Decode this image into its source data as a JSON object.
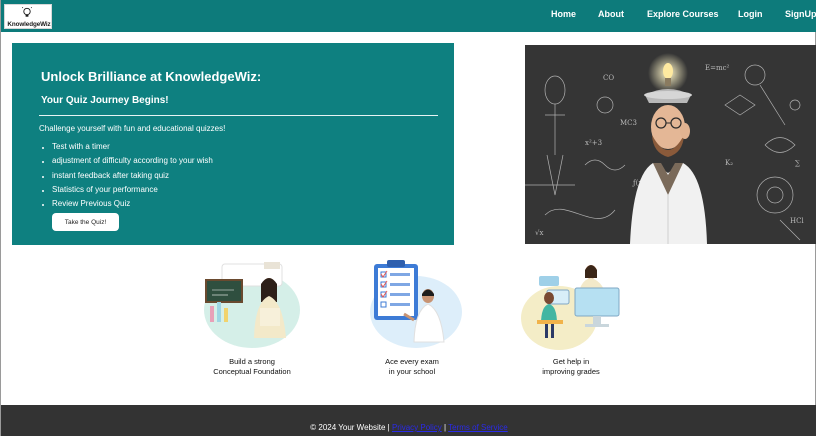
{
  "brand": {
    "logo_text": "KnowledgeWiz"
  },
  "nav": {
    "home": "Home",
    "about": "About",
    "explore": "Explore Courses",
    "login": "Login",
    "signup": "SignUp"
  },
  "hero": {
    "title": "Unlock Brilliance at KnowledgeWiz:",
    "subtitle": "Your Quiz Journey Begins!",
    "intro": "Challenge yourself with fun and educational quizzes!",
    "features": [
      "Test with a timer",
      "adjustment of difficulty according to your wish",
      "instant feedback after taking quiz",
      "Statistics of your performance",
      "Review Previous Quiz"
    ],
    "button_label": "Take the Quiz!"
  },
  "cards": [
    {
      "line1": "Build a strong",
      "line2": "Conceptual Foundation"
    },
    {
      "line1": "Ace every exam",
      "line2": "in your school"
    },
    {
      "line1": "Get help in",
      "line2": "improving grades"
    }
  ],
  "footer": {
    "copyright": "© 2024 Your Website | ",
    "privacy": "Privacy Policy",
    "separator": " | ",
    "terms": "Terms of Service"
  },
  "colors": {
    "nav_bg": "#0d7b7b",
    "hero_bg": "#0e8080",
    "footer_bg": "#333333",
    "link_blue": "#2a2ae8"
  },
  "icons": {
    "logo": "lightbulb-icon",
    "hero_image": "mad-scientist-chalkboard-illustration",
    "card1": "teacher-chalkboard-illustration",
    "card2": "exam-checklist-clipboard-illustration",
    "card3": "online-tutoring-illustration"
  }
}
